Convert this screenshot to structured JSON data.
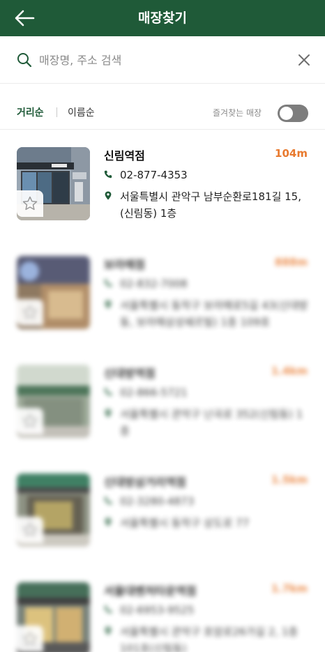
{
  "header": {
    "title": "매장찾기",
    "back_icon": "arrow-left-icon"
  },
  "search": {
    "placeholder": "매장명, 주소 검색",
    "value": "",
    "icon": "search-icon",
    "clear_icon": "close-icon"
  },
  "filters": {
    "sort_distance": "거리순",
    "sort_name": "이름순",
    "active_sort": "거리순",
    "favorites_label": "즐겨찾는 매장",
    "favorites_toggle": "off"
  },
  "colors": {
    "brand": "#1f5a38",
    "distance": "#e87a2f",
    "toggle_off": "#7d7d7d"
  },
  "stores": [
    {
      "name": "신림역점",
      "distance": "104m",
      "phone": "02-877-4353",
      "address": "서울특별시 관악구 남부순환로181길 15, (신림동) 1층"
    },
    {
      "name": "보라매점",
      "distance": "888m",
      "phone": "02-832-7008",
      "address": "서울특별시 동작구 보라매로5길 43(신대방동, 보라매삼성쉐르빌) 1층 109호"
    },
    {
      "name": "신대방역점",
      "distance": "1.4km",
      "phone": "02-866-5721",
      "address": "서울특별시 관악구 난곡로 352(신림동) 1층"
    },
    {
      "name": "신대방삼거리역점",
      "distance": "1.5km",
      "phone": "02-3280-4873",
      "address": "서울특별시 동작구 상도로 77"
    },
    {
      "name": "서울대벤처타운역점",
      "distance": "1.7km",
      "phone": "02-6953-9525",
      "address": "서울특별시 관악구 호암로26가길 2, 1층 101호(신림동)"
    }
  ]
}
